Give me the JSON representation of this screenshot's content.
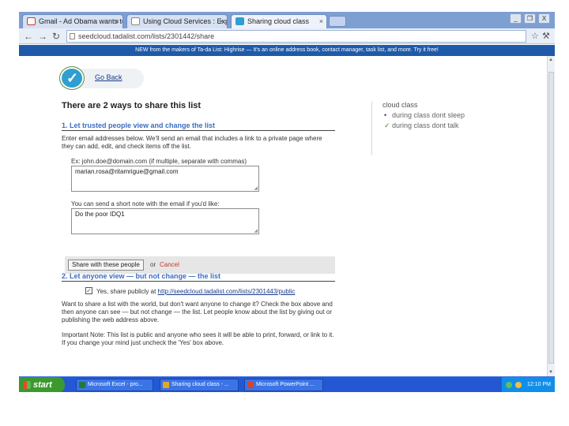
{
  "browser": {
    "tabs": [
      {
        "label": "Gmail - Ad Obama wants to...",
        "icon": "gmail-icon",
        "active": false
      },
      {
        "label": "Using Cloud Services : Explori...",
        "icon": "page-icon",
        "active": false
      },
      {
        "label": "Sharing cloud class",
        "icon": "tadalist-icon",
        "active": true
      }
    ],
    "window_controls": [
      "_",
      "❐",
      "X"
    ],
    "url": "seedcloud.tadalist.com/lists/2301442/share"
  },
  "banner": "NEW from the makers of Ta-da List: Highrise — It's an online address book, contact manager, task list, and more. Try it free!",
  "page": {
    "go_back": "Go Back",
    "title": "There are 2 ways to share this list",
    "section1": {
      "heading": "1. Let trusted people view and change the list",
      "intro": "Enter email addresses below. We'll send an email that includes a link to a private page where they can add, edit, and check items off the list.",
      "emails_label": "Ex: john.doe@domain.com (if multiple, separate with commas)",
      "emails_value": "marian.rosa@ritamrigue@gmail.com",
      "message_label": "You can send a short note with the email if you'd like:",
      "message_value": "Do the poor IDQ1",
      "share_button": "Share with these people",
      "or": "or",
      "cancel": "Cancel"
    },
    "section2": {
      "heading": "2. Let anyone view — but not change — the list",
      "checkbox_label": "Yes, share publicly at",
      "checkbox_checked": true,
      "public_url": "http://seedcloud.tadalist.com/lists/2301443/public",
      "description": "Want to share a list with the world, but don't want anyone to change it? Check the box above and then anyone can see — but not change — the list. Let people know about the list by giving out or publishing the web address above.",
      "note": "Important Note: This list is public and anyone who sees it will be able to print, forward, or link to it. If you change your mind just uncheck the 'Yes' box above."
    }
  },
  "sidebar": {
    "list_name": "cloud class",
    "items": [
      {
        "text": "during class dont sleep",
        "done": false
      },
      {
        "text": "during class dont talk",
        "done": true
      }
    ]
  },
  "taskbar": {
    "start": "start",
    "tasks": [
      {
        "label": "Microsoft Excel - pro...",
        "icon_color": "#1f7a3a"
      },
      {
        "label": "Sharing cloud class - ...",
        "icon_color": "#e5a823"
      },
      {
        "label": "Microsoft PowerPoint ...",
        "icon_color": "#d24726"
      }
    ],
    "clock": "12:10 PM"
  }
}
